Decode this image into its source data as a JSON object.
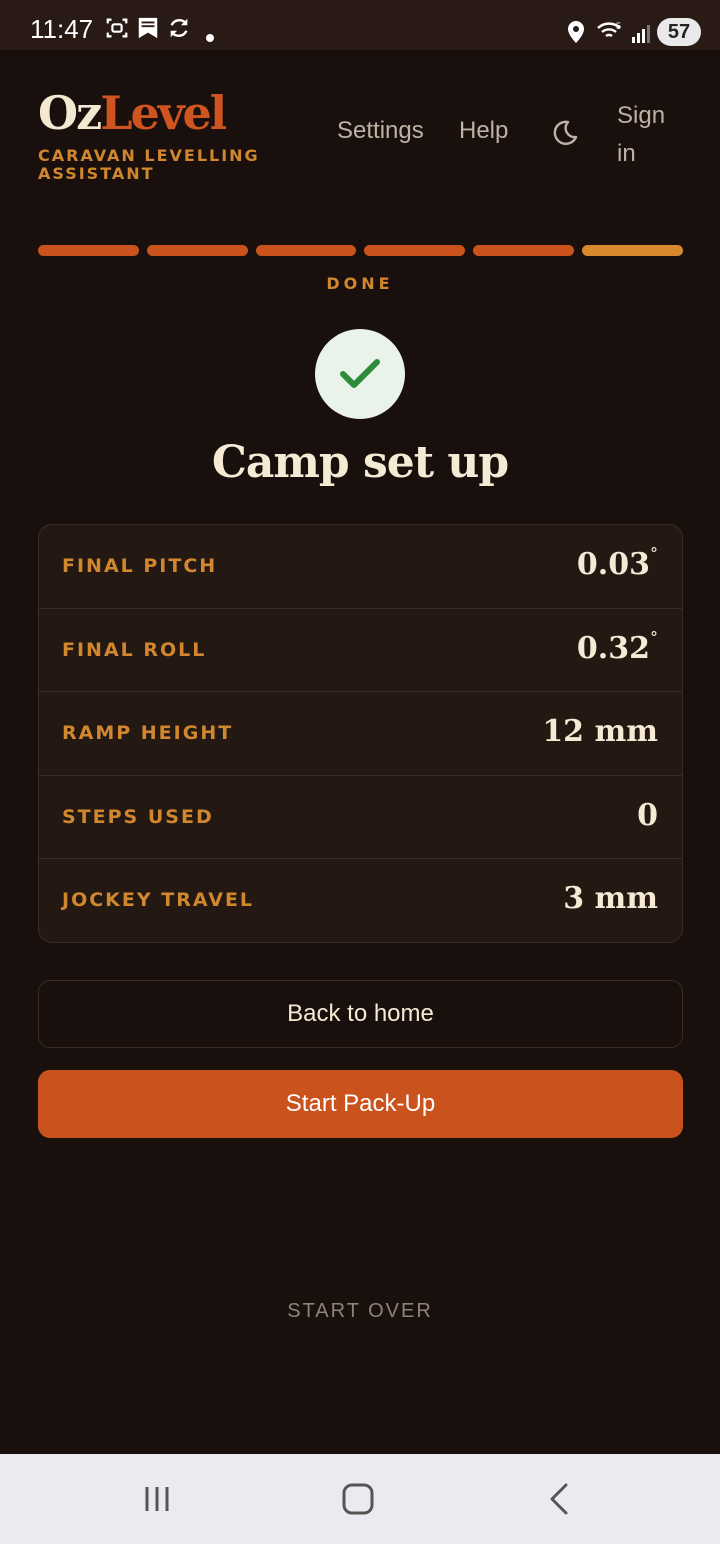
{
  "status_bar": {
    "time": "11:47",
    "battery": "57"
  },
  "header": {
    "logo_part1": "Oz",
    "logo_part2": "Level",
    "tagline": "CARAVAN LEVELLING ASSISTANT",
    "nav": {
      "settings": "Settings",
      "help": "Help",
      "sign_in_line1": "Sign",
      "sign_in_line2": "in"
    }
  },
  "progress": {
    "completed_steps": 6,
    "total_steps": 6,
    "step_label": "DONE"
  },
  "main": {
    "title": "Camp set up",
    "stats": [
      {
        "label": "FINAL PITCH",
        "value": "0.03",
        "unit": "°"
      },
      {
        "label": "FINAL ROLL",
        "value": "0.32",
        "unit": "°"
      },
      {
        "label": "RAMP HEIGHT",
        "value": "12 mm",
        "unit": ""
      },
      {
        "label": "STEPS USED",
        "value": "0",
        "unit": ""
      },
      {
        "label": "JOCKEY TRAVEL",
        "value": "3 mm",
        "unit": ""
      }
    ]
  },
  "actions": {
    "back_home": "Back to home",
    "start_packup": "Start Pack-Up",
    "start_over": "START OVER"
  },
  "colors": {
    "background": "#190f0c",
    "accent": "#c9521d",
    "label_orange": "#d0872d",
    "success_green": "#2e8b3a"
  }
}
